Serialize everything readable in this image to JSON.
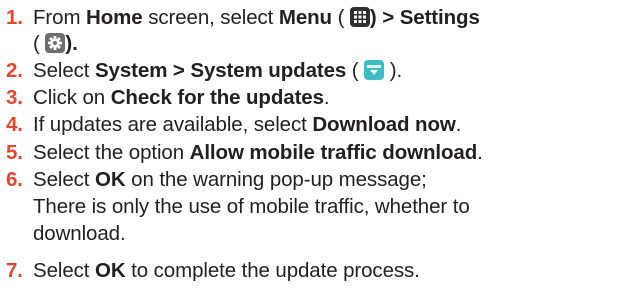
{
  "steps": [
    {
      "number": "1.",
      "parts": {
        "t1": "From ",
        "b1": "Home",
        "t2": " screen, select ",
        "b2": "Menu",
        "t3": " ( ",
        "b3": ") > Settings",
        "t4": "(",
        "b4": ")."
      },
      "icons": [
        "menu-grid-icon",
        "gear-icon"
      ]
    },
    {
      "number": "2.",
      "parts": {
        "t1": "Select ",
        "b1": "System > System updates",
        "t2": " ( ",
        "t3": " )."
      },
      "icons": [
        "system-update-icon"
      ]
    },
    {
      "number": "3.",
      "parts": {
        "t1": "Click on ",
        "b1": "Check for the updates",
        "t2": "."
      }
    },
    {
      "number": "4.",
      "parts": {
        "t1": "If updates are available, select ",
        "b1": "Download now",
        "t2": "."
      }
    },
    {
      "number": "5.",
      "parts": {
        "t1": "Select the option ",
        "b1": "Allow mobile traffic download",
        "t2": "."
      }
    },
    {
      "number": "6.",
      "parts": {
        "t1": "Select ",
        "b1": "OK",
        "t2": " on the warning pop-up message;",
        "line2": "There is only the use of mobile traffic, whether to",
        "line3": "download."
      }
    },
    {
      "number": "7.",
      "parts": {
        "t1": "Select ",
        "b1": "OK",
        "t2": " to complete the update process."
      }
    }
  ],
  "colors": {
    "step_number": "#e2462f",
    "text": "#231f20",
    "menu_icon_bg": "#2f2f2f",
    "gear_icon_bg": "#6d6e70",
    "update_icon_bg": "#3cbcc3"
  }
}
